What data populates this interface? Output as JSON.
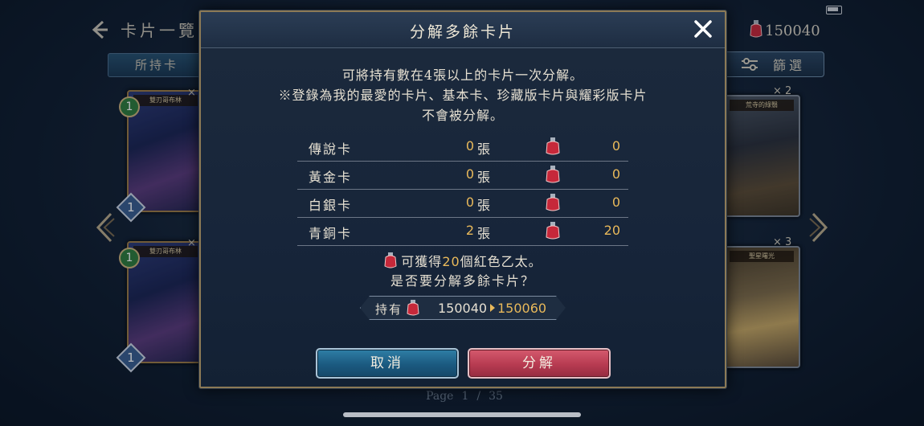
{
  "background": {
    "title": "卡片一覽",
    "ether_amount": "150040",
    "tab_label": "所持卡",
    "filter_label": "篩選",
    "cards": [
      {
        "name": "雙刃哥布林",
        "cost": "1",
        "gem": "1",
        "count": "×"
      },
      {
        "name": "雙刃哥布林",
        "cost": "1",
        "gem": "1",
        "count": "×"
      },
      {
        "name": "荒寺的綠翳",
        "count": "× 2"
      },
      {
        "name": "聖星曙光",
        "count": "× 3"
      }
    ],
    "page": {
      "label": "Page",
      "current": "1",
      "separator": "/",
      "total": "35"
    }
  },
  "modal": {
    "title": "分解多餘卡片",
    "desc_line1": "可將持有數在4張以上的卡片一次分解。",
    "desc_line2": "※登錄為我的最愛的卡片、基本卡、珍藏版卡片與耀彩版卡片",
    "desc_line3": "不會被分解。",
    "rows": [
      {
        "name": "傳說卡",
        "count": "0",
        "unit": "張",
        "ether": "0"
      },
      {
        "name": "黃金卡",
        "count": "0",
        "unit": "張",
        "ether": "0"
      },
      {
        "name": "白銀卡",
        "count": "0",
        "unit": "張",
        "ether": "0"
      },
      {
        "name": "青銅卡",
        "count": "2",
        "unit": "張",
        "ether": "20"
      }
    ],
    "gain_prefix": "可獲得",
    "gain_amount": "20",
    "gain_suffix": "個紅色乙太。",
    "confirm_text": "是否要分解多餘卡片？",
    "holding_label": "持有",
    "holding_old": "150040",
    "holding_new": "150060",
    "cancel_label": "取消",
    "ok_label": "分解"
  },
  "colors": {
    "accent_gold": "#e9b95a",
    "cancel_blue": "#1b5a80",
    "ok_red": "#b73b51"
  },
  "icons": [
    "back-icon",
    "red-ether-icon",
    "filter-icon",
    "close-icon",
    "arrow-left-icon",
    "arrow-right-icon"
  ]
}
